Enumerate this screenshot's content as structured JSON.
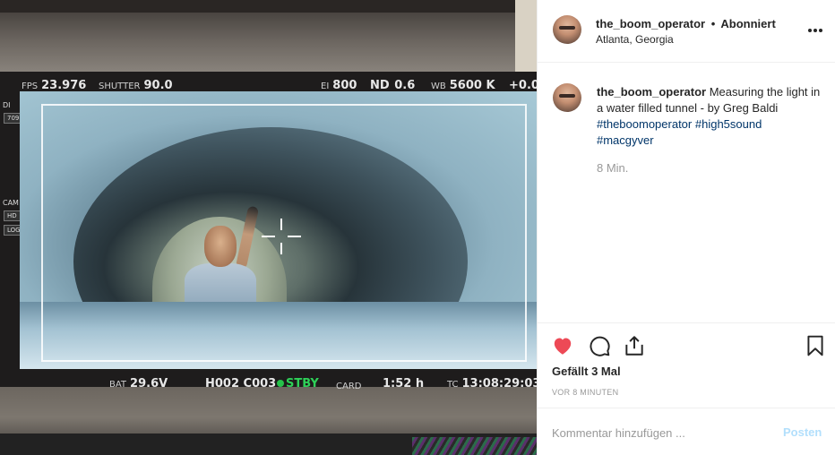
{
  "photo": {
    "osd": {
      "fps_label": "FPS",
      "fps": "23.976",
      "shutter_label": "SHUTTER",
      "shutter": "90.0",
      "ei_label": "EI",
      "ei": "800",
      "nd_label": "ND",
      "nd": "0.6",
      "wb_label": "WB",
      "wb": "5600 K",
      "tint": "+0.0",
      "side_di": "DI",
      "side_cam": "CAM",
      "side_hd": "HD",
      "side_log": "LOG",
      "side_709": "709",
      "bat_label": "BAT",
      "bat": "29.6V",
      "clip": "H002 C003",
      "status": "STBY",
      "card_label": "CARD",
      "card": "1:52 h",
      "tc_label": "TC",
      "timecode": "13:08:29:03"
    }
  },
  "header": {
    "username": "the_boom_operator",
    "separator": "•",
    "follow_status": "Abonniert",
    "location": "Atlanta, Georgia"
  },
  "caption": {
    "username": "the_boom_operator",
    "text": "Measuring the light in a water filled tunnel - by Greg Baldi",
    "hashtags": [
      "#theboomoperator",
      "#high5sound",
      "#macgyver"
    ],
    "time": "8 Min."
  },
  "actions": {
    "likes": "Gefällt 3 Mal",
    "posted_ago": "VOR 8 MINUTEN"
  },
  "comment": {
    "placeholder": "Kommentar hinzufügen ...",
    "post_label": "Posten"
  },
  "colors": {
    "like_heart": "#ed4956",
    "hashtag": "#003569",
    "post_button": "#b2dffc",
    "stby_green": "#2ed158"
  },
  "icons": [
    "more-options-icon",
    "heart-icon",
    "comment-icon",
    "share-icon",
    "bookmark-icon",
    "crosshair-icon"
  ]
}
